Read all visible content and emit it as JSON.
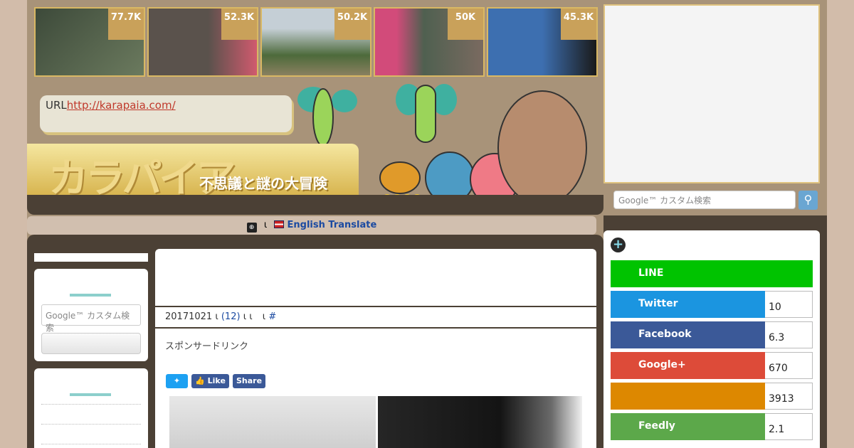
{
  "thumbnails": [
    {
      "count": "77.7K",
      "colors": [
        "#3d4a3a",
        "#6b7a5e"
      ]
    },
    {
      "count": "52.3K",
      "colors": [
        "#5a524c",
        "#d05a6e"
      ]
    },
    {
      "count": "50.2K",
      "colors": [
        "#c5cfd6",
        "#4d6a3b"
      ]
    },
    {
      "count": "50K",
      "colors": [
        "#d24b7a",
        "#4f6050"
      ]
    },
    {
      "count": "45.3K",
      "colors": [
        "#3d6fb0",
        "#1a1a1a"
      ]
    }
  ],
  "header": {
    "url_label": "URL",
    "url": "http://karapaia.com/",
    "logo_title": "カラパイア",
    "logo_subtitle": "不思議と謎の大冒険"
  },
  "translate": {
    "sep": "ι",
    "label": "English Translate"
  },
  "right_search": {
    "placeholder": "Google™ カスタム検索"
  },
  "left_search": {
    "placeholder": "Google™ カスタム検索"
  },
  "article": {
    "title": "",
    "meta_date": "20171021",
    "meta_comments": "(12)",
    "meta_sep": "ι ι",
    "meta_sep2": "ι",
    "meta_hash": "#",
    "sponsor": "スポンサードリンク",
    "share_buttons": [
      {
        "label": "",
        "color": "#1da1f2"
      },
      {
        "label": "Like",
        "color": "#3b5998"
      },
      {
        "label": "Share",
        "color": "#3b5998"
      }
    ]
  },
  "share_panel": {
    "rows": [
      {
        "label": "LINE",
        "count": "",
        "color": "#00c300"
      },
      {
        "label": "Twitter",
        "count": "10",
        "color": "#1b95e0"
      },
      {
        "label": "Facebook",
        "count": "6.3",
        "color": "#3b5998"
      },
      {
        "label": "Google+",
        "count": "670",
        "color": "#dd4b39"
      },
      {
        "label": "",
        "count": "3913",
        "color": "#dd8800"
      },
      {
        "label": "Feedly",
        "count": "2.1",
        "color": "#6cc655"
      }
    ]
  }
}
